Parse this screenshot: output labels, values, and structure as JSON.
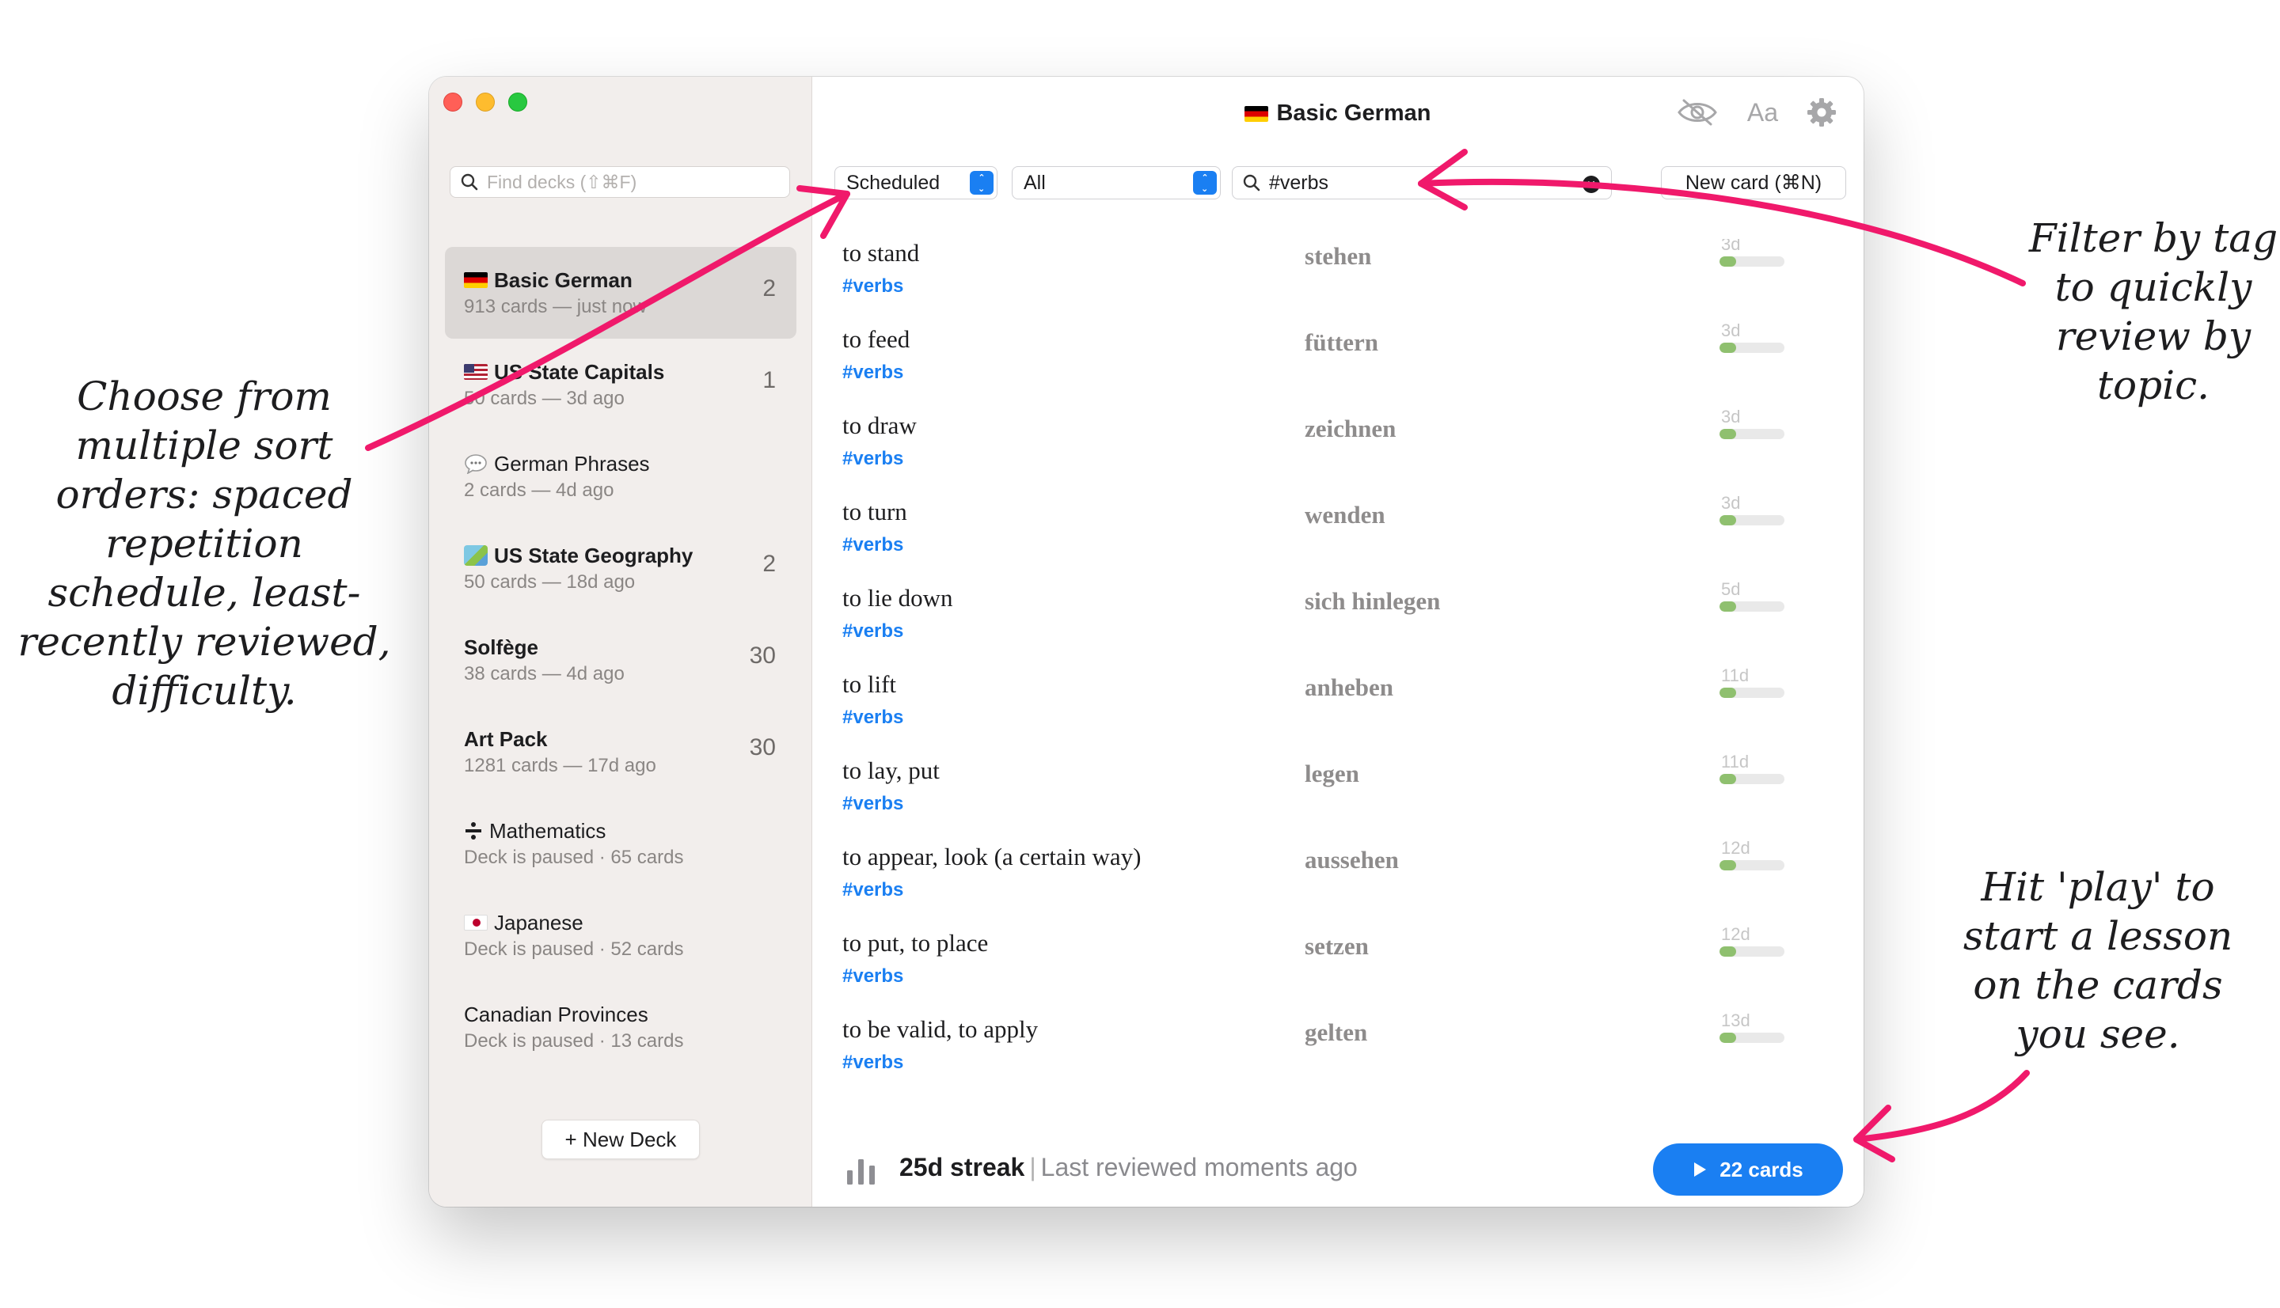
{
  "window": {
    "title": "Basic German",
    "title_flag": "de-flag-icon",
    "toolbar_icons": [
      "eye-slash-icon",
      "font-icon",
      "gear-icon"
    ],
    "font_button_label": "Aa"
  },
  "sidebar": {
    "search_placeholder": "Find decks (⇧⌘F)",
    "decks": [
      {
        "name": "Basic German",
        "meta": "913 cards — just now",
        "count": "2",
        "icon": "de-flag-icon",
        "bold": true,
        "selected": true
      },
      {
        "name": "US State Capitals",
        "meta": "50 cards — 3d ago",
        "count": "1",
        "icon": "us-flag-icon",
        "bold": true
      },
      {
        "name": "German Phrases",
        "meta": "2 cards — 4d ago",
        "count": "",
        "icon": "speech-bubble-icon",
        "bold": false
      },
      {
        "name": "US State Geography",
        "meta": "50 cards — 18d ago",
        "count": "2",
        "icon": "map-icon",
        "bold": true
      },
      {
        "name": "Solfège",
        "meta": "38 cards — 4d ago",
        "count": "30",
        "icon": "",
        "bold": true
      },
      {
        "name": "Art Pack",
        "meta": "1281 cards — 17d ago",
        "count": "30",
        "icon": "",
        "bold": true
      },
      {
        "name": "Mathematics",
        "meta": "Deck is paused · 65 cards",
        "count": "",
        "icon": "divide-icon",
        "bold": false
      },
      {
        "name": "Japanese",
        "meta": "Deck is paused · 52 cards",
        "count": "",
        "icon": "jp-flag-icon",
        "bold": false
      },
      {
        "name": "Canadian Provinces",
        "meta": "Deck is paused · 13 cards",
        "count": "",
        "icon": "",
        "bold": false
      }
    ],
    "new_deck_label": "+ New Deck"
  },
  "filters": {
    "sort_value": "Scheduled",
    "scope_value": "All",
    "search_value": "#verbs",
    "new_card_label": "New card (⌘N)"
  },
  "cards": [
    {
      "front": "to stand",
      "tag": "#verbs",
      "back": "stehen",
      "due": "3d",
      "progress": 0.25
    },
    {
      "front": "to feed",
      "tag": "#verbs",
      "back": "füttern",
      "due": "3d",
      "progress": 0.25
    },
    {
      "front": "to draw",
      "tag": "#verbs",
      "back": "zeichnen",
      "due": "3d",
      "progress": 0.25
    },
    {
      "front": "to turn",
      "tag": "#verbs",
      "back": "wenden",
      "due": "3d",
      "progress": 0.25
    },
    {
      "front": "to lie down",
      "tag": "#verbs",
      "back": "sich hinlegen",
      "due": "5d",
      "progress": 0.25
    },
    {
      "front": "to lift",
      "tag": "#verbs",
      "back": "anheben",
      "due": "11d",
      "progress": 0.25
    },
    {
      "front": "to lay, put",
      "tag": "#verbs",
      "back": "legen",
      "due": "11d",
      "progress": 0.25
    },
    {
      "front": "to appear, look (a certain way)",
      "tag": "#verbs",
      "back": "aussehen",
      "due": "12d",
      "progress": 0.25
    },
    {
      "front": "to put, to place",
      "tag": "#verbs",
      "back": "setzen",
      "due": "12d",
      "progress": 0.25
    },
    {
      "front": "to be valid, to apply",
      "tag": "#verbs",
      "back": "gelten",
      "due": "13d",
      "progress": 0.25
    }
  ],
  "footer": {
    "streak": "25d streak",
    "separator": "|",
    "last_reviewed": "Last reviewed moments ago",
    "play_label": "22 cards"
  },
  "annotations": {
    "left": "Choose from multiple sort orders: spaced repetition schedule, least-recently reviewed, difficulty.",
    "right_top": "Filter by tag to quickly review by topic.",
    "right_bottom": "Hit 'play' to start a lesson on the cards you see."
  },
  "colors": {
    "accent": "#1a7ff2",
    "arrow": "#f0196b",
    "progress": "#8fc06f",
    "sidebar_bg": "#f2eeec"
  }
}
